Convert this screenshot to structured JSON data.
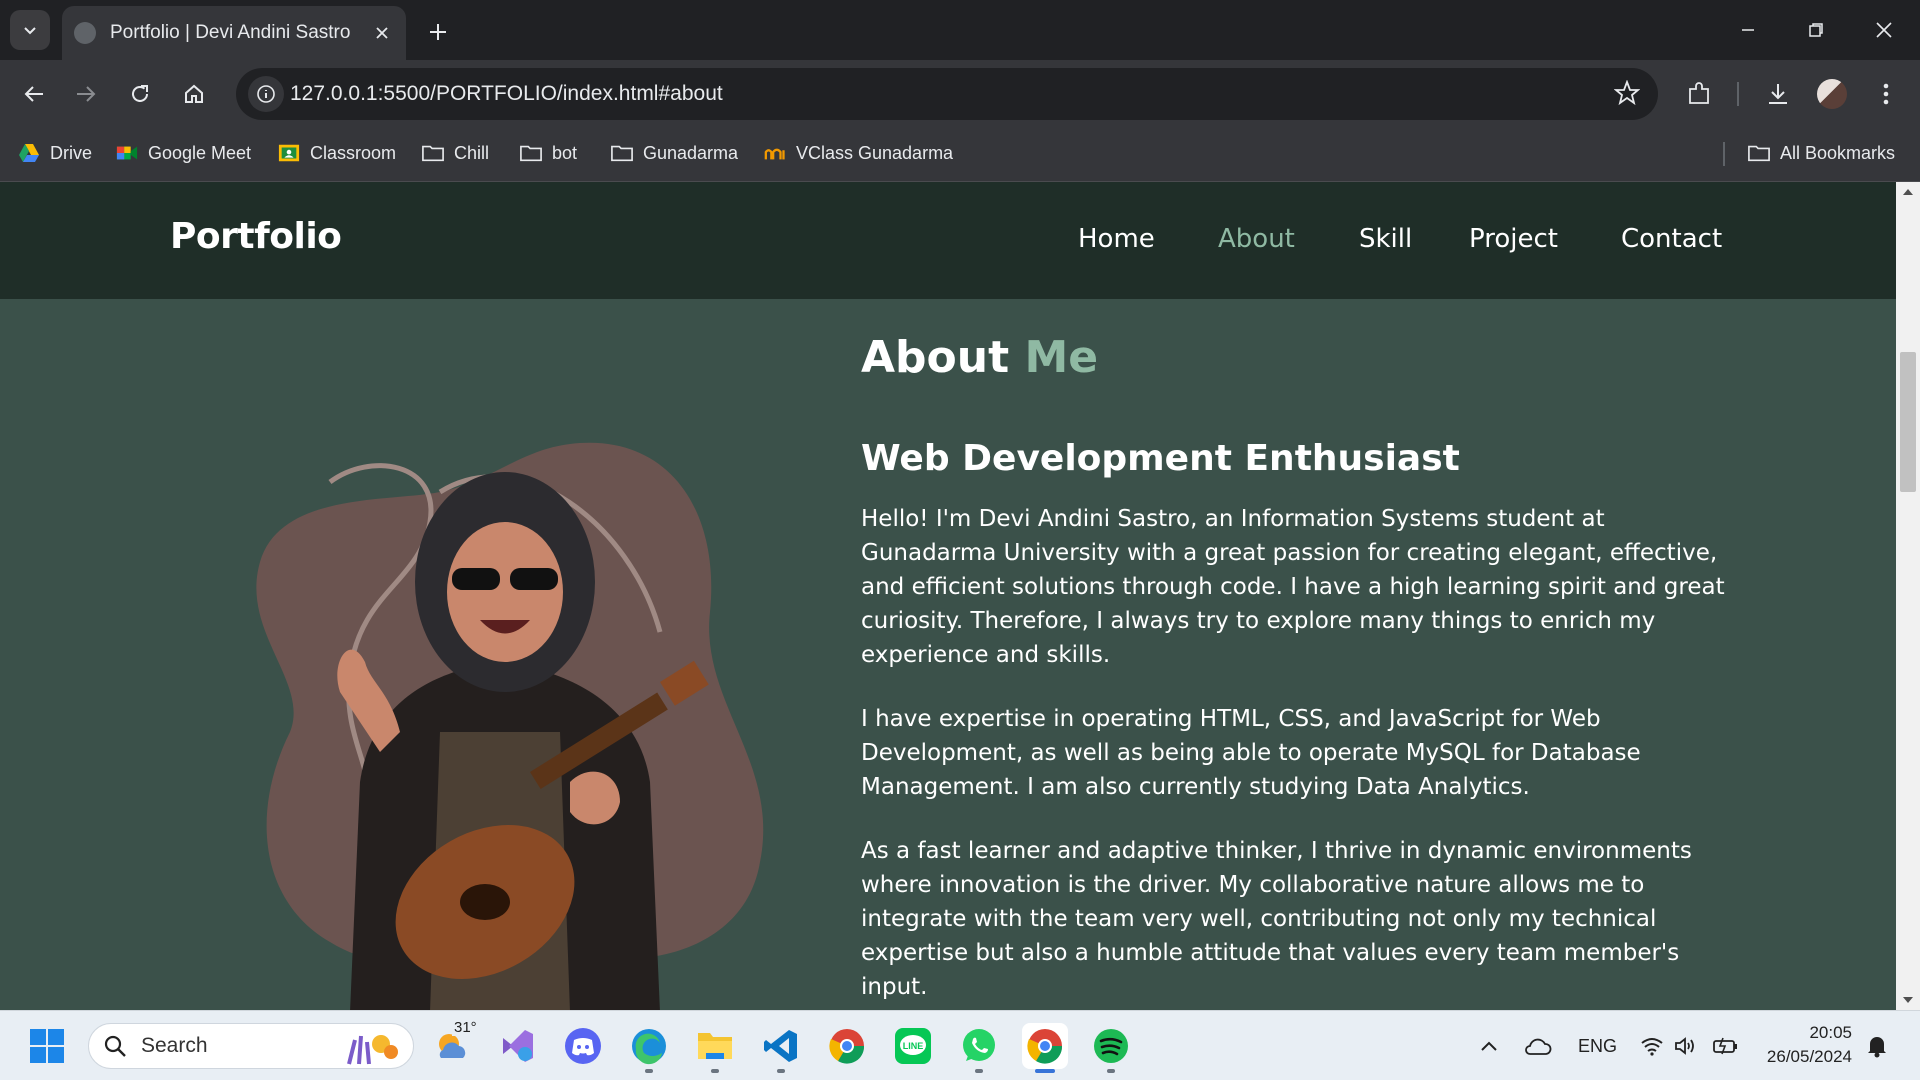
{
  "browser": {
    "tab_title": "Portfolio | Devi Andini Sastro",
    "url": "127.0.0.1:5500/PORTFOLIO/index.html#about",
    "bookmarks": [
      {
        "label": "Drive",
        "icon": "drive-icon"
      },
      {
        "label": "Google Meet",
        "icon": "google-meet-icon"
      },
      {
        "label": "Classroom",
        "icon": "classroom-icon"
      },
      {
        "label": "Chill",
        "icon": "folder-icon"
      },
      {
        "label": "bot",
        "icon": "folder-icon"
      },
      {
        "label": "Gunadarma",
        "icon": "folder-icon"
      },
      {
        "label": "VClass Gunadarma",
        "icon": "vclass-icon"
      }
    ],
    "all_bookmarks": "All Bookmarks"
  },
  "site": {
    "brand": "Portfolio",
    "nav": [
      {
        "label": "Home",
        "active": false
      },
      {
        "label": "About",
        "active": true
      },
      {
        "label": "Skill",
        "active": false
      },
      {
        "label": "Project",
        "active": false
      },
      {
        "label": "Contact",
        "active": false
      }
    ],
    "about": {
      "title_main": "About",
      "title_accent": "Me",
      "subtitle": "Web Development Enthusiast",
      "paragraphs": [
        "Hello! I'm Devi Andini Sastro, an Information Systems student at Gunadarma University with a great passion for creating elegant, effective, and efficient solutions through code. I have a high learning spirit and great curiosity. Therefore, I always try to explore many things to enrich my experience and skills.",
        "I have expertise in operating HTML, CSS, and JavaScript for Web Development, as well as being able to operate MySQL for Database Management. I am also currently studying Data Analytics.",
        "As a fast learner and adaptive thinker, I thrive in dynamic environments where innovation is the driver. My collaborative nature allows me to integrate with the team very well, contributing not only my technical expertise but also a humble attitude that values every team member's input."
      ]
    }
  },
  "taskbar": {
    "search_label": "Search",
    "weather_temp": "31°",
    "language": "ENG",
    "time": "20:05",
    "date": "26/05/2024"
  },
  "colors": {
    "nav_bg": "#1f2e28",
    "page_bg": "#3b514a",
    "accent": "#8fb9a3",
    "blob": "#6b5450"
  }
}
